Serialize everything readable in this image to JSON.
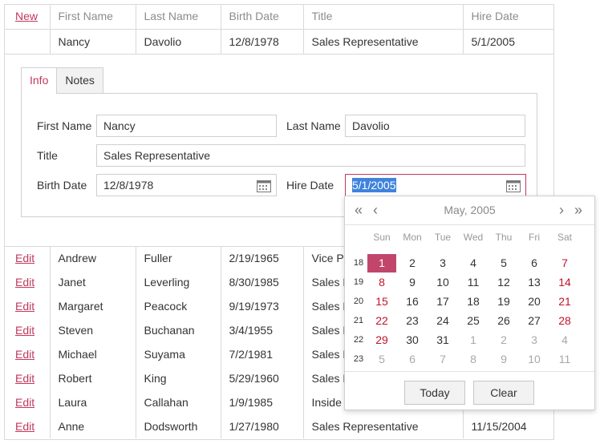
{
  "grid": {
    "new_label": "New",
    "headers": [
      "First Name",
      "Last Name",
      "Birth Date",
      "Title",
      "Hire Date"
    ],
    "edit_row": [
      "Nancy",
      "Davolio",
      "12/8/1978",
      "Sales Representative",
      "5/1/2005"
    ],
    "edit_label": "Edit",
    "rows": [
      [
        "Andrew",
        "Fuller",
        "2/19/1965",
        "Vice Pr",
        ""
      ],
      [
        "Janet",
        "Leverling",
        "8/30/1985",
        "Sales R",
        ""
      ],
      [
        "Margaret",
        "Peacock",
        "9/19/1973",
        "Sales R",
        ""
      ],
      [
        "Steven",
        "Buchanan",
        "3/4/1955",
        "Sales M",
        ""
      ],
      [
        "Michael",
        "Suyama",
        "7/2/1981",
        "Sales R",
        ""
      ],
      [
        "Robert",
        "King",
        "5/29/1960",
        "Sales R",
        ""
      ],
      [
        "Laura",
        "Callahan",
        "1/9/1985",
        "Inside",
        ""
      ],
      [
        "Anne",
        "Dodsworth",
        "1/27/1980",
        "Sales Representative",
        "11/15/2004"
      ]
    ]
  },
  "form": {
    "tabs": [
      "Info",
      "Notes"
    ],
    "first_name_label": "First Name",
    "first_name_value": "Nancy",
    "last_name_label": "Last Name",
    "last_name_value": "Davolio",
    "title_label": "Title",
    "title_value": "Sales Representative",
    "birth_date_label": "Birth Date",
    "birth_date_value": "12/8/1978",
    "hire_date_label": "Hire Date",
    "hire_date_value": "5/1/2005"
  },
  "calendar": {
    "title": "May, 2005",
    "prev_year": "«",
    "prev_month": "‹",
    "next_month": "›",
    "next_year": "»",
    "days_of_week": [
      "Sun",
      "Mon",
      "Tue",
      "Wed",
      "Thu",
      "Fri",
      "Sat"
    ],
    "weeks": [
      {
        "num": "18",
        "days": [
          "1",
          "2",
          "3",
          "4",
          "5",
          "6",
          "7"
        ]
      },
      {
        "num": "19",
        "days": [
          "8",
          "9",
          "10",
          "11",
          "12",
          "13",
          "14"
        ]
      },
      {
        "num": "20",
        "days": [
          "15",
          "16",
          "17",
          "18",
          "19",
          "20",
          "21"
        ]
      },
      {
        "num": "21",
        "days": [
          "22",
          "23",
          "24",
          "25",
          "26",
          "27",
          "28"
        ]
      },
      {
        "num": "22",
        "days": [
          "29",
          "30",
          "31",
          "1",
          "2",
          "3",
          "4"
        ]
      },
      {
        "num": "23",
        "days": [
          "5",
          "6",
          "7",
          "8",
          "9",
          "10",
          "11"
        ]
      }
    ],
    "selected_day": "1",
    "today_label": "Today",
    "clear_label": "Clear",
    "accent_color": "#c2466b",
    "weekend_color": "#c0142c"
  }
}
